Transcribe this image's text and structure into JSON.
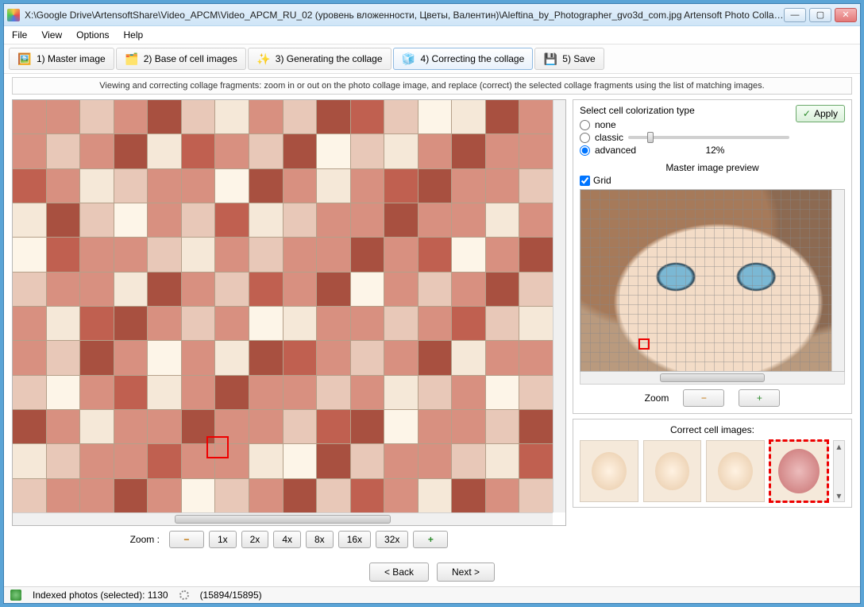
{
  "title": "X:\\Google Drive\\ArtensoftShare\\Video_APCM\\Video_APCM_RU_02 (уровень вложенности, Цветы, Валентин)\\Aleftina_by_Photographer_gvo3d_com.jpg Artensoft Photo Collag...",
  "menu": {
    "file": "File",
    "view": "View",
    "options": "Options",
    "help": "Help"
  },
  "steps": {
    "s1": "1) Master image",
    "s2": "2) Base of cell images",
    "s3": "3) Generating the collage",
    "s4": "4) Correcting the collage",
    "s5": "5) Save"
  },
  "infobar": "Viewing and correcting collage fragments: zoom in or out on the photo collage image, and replace (correct) the selected collage fragments using the list of matching images.",
  "left": {
    "zoom_label": "Zoom   :",
    "z1": "1x",
    "z2": "2x",
    "z4": "4x",
    "z8": "8x",
    "z16": "16x",
    "z32": "32x"
  },
  "color_panel": {
    "title": "Select cell colorization type",
    "none": "none",
    "classic": "classic",
    "advanced": "advanced",
    "percent": "12%",
    "apply": "Apply"
  },
  "preview": {
    "title": "Master image preview",
    "grid": "Grid",
    "zoom": "Zoom"
  },
  "correct": {
    "title": "Correct cell images:"
  },
  "nav": {
    "back": "< Back",
    "next": "Next >"
  },
  "status": {
    "indexed": "Indexed photos (selected): 1130",
    "progress": "(15894/15895)"
  },
  "glyph": {
    "plus": "+",
    "minus": "−",
    "check": "✓",
    "min": "—",
    "max": "▢",
    "close": "✕",
    "up": "▴",
    "down": "▾"
  }
}
